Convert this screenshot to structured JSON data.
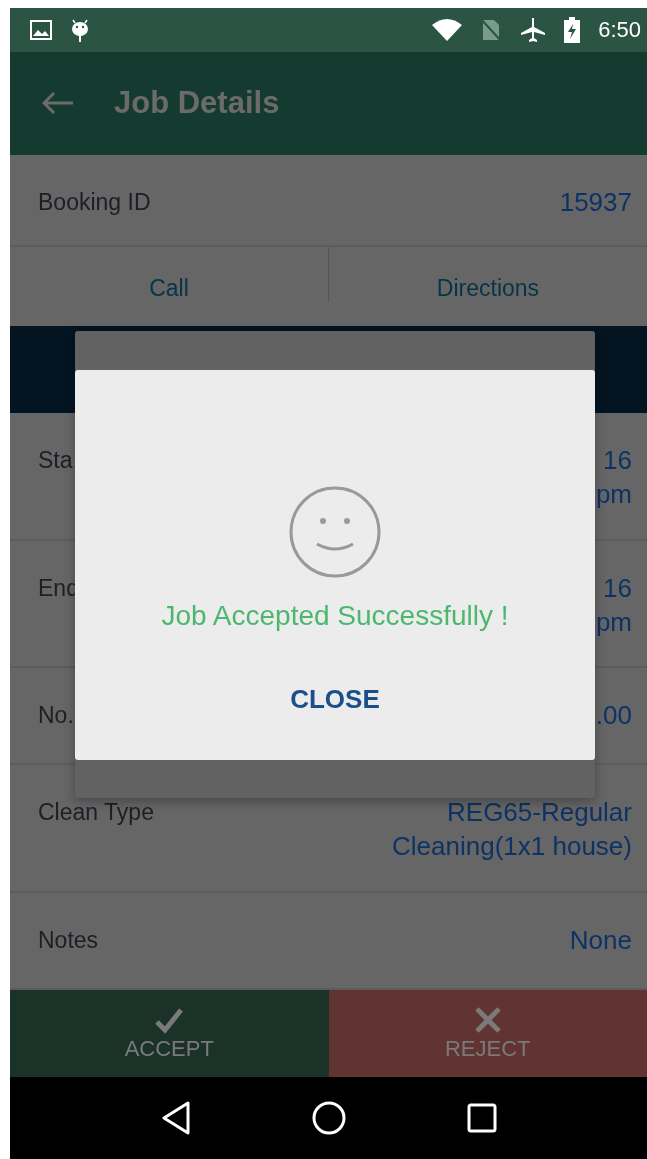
{
  "status_bar": {
    "time": "6:50"
  },
  "app_bar": {
    "title": "Job Details"
  },
  "booking": {
    "label": "Booking ID",
    "value": "15937"
  },
  "contact_actions": [
    "Call",
    "Directions"
  ],
  "details": [
    {
      "label": "Sta",
      "value_lines": [
        "16",
        "pm"
      ]
    },
    {
      "label": "End",
      "value_lines": [
        "16",
        "pm"
      ]
    },
    {
      "label": "No.",
      "value_lines": [
        ".00"
      ]
    },
    {
      "label": "Clean Type",
      "value_lines": [
        "REG65-Regular",
        "Cleaning(1x1 house)"
      ]
    },
    {
      "label": "Notes",
      "value_lines": [
        "None"
      ]
    }
  ],
  "dialog": {
    "message": "Job Accepted Successfully !",
    "button": "CLOSE"
  },
  "actions": [
    {
      "kind": "accept",
      "label": "ACCEPT"
    },
    {
      "kind": "reject",
      "label": "REJECT"
    }
  ]
}
